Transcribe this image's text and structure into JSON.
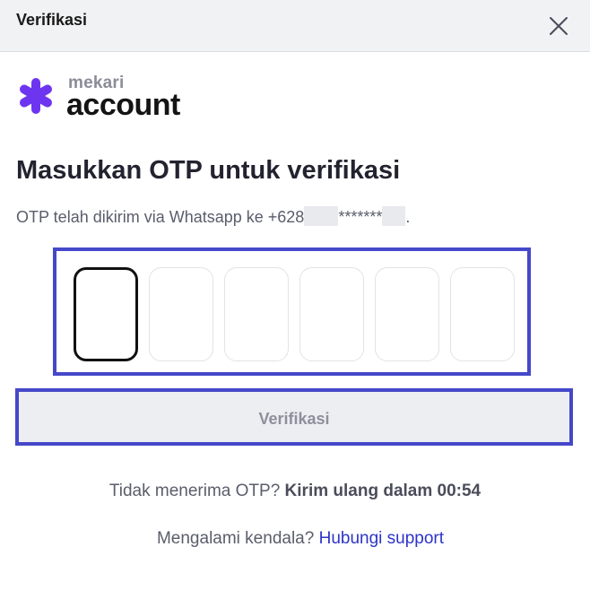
{
  "header": {
    "title": "Verifikasi",
    "close_icon": "close-icon"
  },
  "logo": {
    "small_text": "mekari",
    "big_text": "account",
    "icon": "mekari-star-icon",
    "brand_color": "#6E35F0"
  },
  "main": {
    "heading": "Masukkan OTP untuk verifikasi",
    "info_prefix": "OTP telah dikirim via Whatsapp ke +628",
    "info_mask": "*******",
    "info_suffix": ".",
    "otp_inputs": [
      "",
      "",
      "",
      "",
      "",
      ""
    ],
    "verify_label": "Verifikasi"
  },
  "resend": {
    "prompt": "Tidak menerima OTP? ",
    "countdown_text": "Kirim ulang dalam 00:54"
  },
  "support": {
    "prompt": "Mengalami kendala? ",
    "link_text": "Hubungi support"
  },
  "colors": {
    "accent_outline": "#4548C9",
    "link": "#2D34C8",
    "header_bg": "#F1F2F4"
  }
}
